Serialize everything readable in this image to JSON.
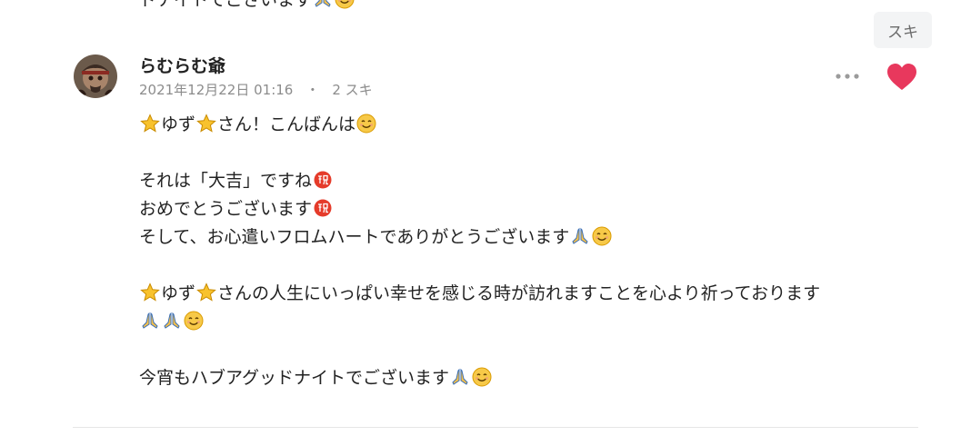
{
  "prev_comment": {
    "tail_text": "ドナイトでございます"
  },
  "like_toggle": {
    "label": "スキ"
  },
  "comment": {
    "author": "らむらむ爺",
    "timestamp": "2021年12月22日 01:16",
    "separator": "・",
    "likes": "2 スキ",
    "lines": {
      "l1a": "ゆず",
      "l1b": "さん！こんばんは",
      "l2": "それは「大吉」ですね",
      "l3": "おめでとうございます",
      "l4": "そして、お心遣いフロムハートでありがとうございます",
      "l5a": "ゆず",
      "l5b": "さんの人生にいっぱい幸せを感じる時が訪れますことを心より祈っております",
      "l7": "今宵もハブアグッドナイトでございます"
    },
    "emoji": {
      "star": "star-emoji",
      "smile": "smiling-face-emoji",
      "celebrate": "congratulations-emoji",
      "pray": "folded-hands-emoji"
    },
    "heart_color": "#e8385d"
  }
}
